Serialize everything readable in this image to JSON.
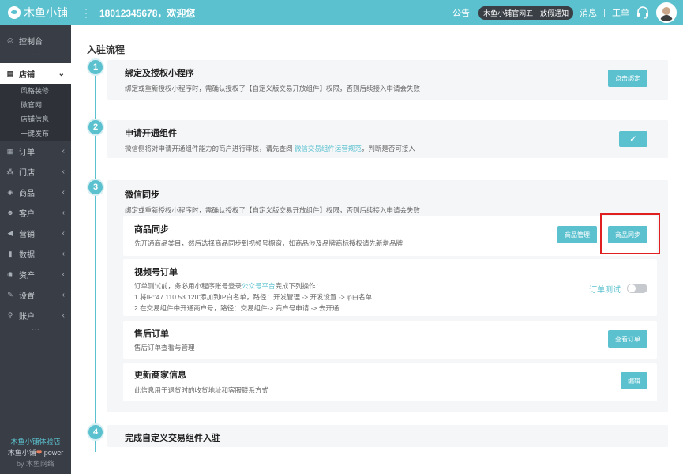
{
  "topbar": {
    "brand": "木鱼小铺",
    "menu_icon": "⋮",
    "welcome": "18012345678，欢迎您",
    "notice_label": "公告:",
    "notice_tag": "木鱼小铺官网五一放假通知",
    "messages": "消息",
    "divider": "|",
    "workorder": "工单"
  },
  "sidebar": {
    "items": [
      {
        "label": "控制台",
        "icon": "dashboard-icon",
        "glyph": "◎"
      },
      {
        "label": "店铺",
        "icon": "store-icon",
        "glyph": "▤",
        "arrow": "⌄"
      },
      {
        "label": "订单",
        "icon": "order-icon",
        "glyph": "▦",
        "arrow": "‹"
      },
      {
        "label": "门店",
        "icon": "branch-icon",
        "glyph": "⁂",
        "arrow": "‹"
      },
      {
        "label": "商品",
        "icon": "goods-icon",
        "glyph": "◈",
        "arrow": "‹"
      },
      {
        "label": "客户",
        "icon": "customer-icon",
        "glyph": "☻",
        "arrow": "‹"
      },
      {
        "label": "营销",
        "icon": "marketing-icon",
        "glyph": "◀",
        "arrow": "‹"
      },
      {
        "label": "数据",
        "icon": "data-icon",
        "glyph": "▮",
        "arrow": "‹"
      },
      {
        "label": "资产",
        "icon": "asset-icon",
        "glyph": "◉",
        "arrow": "‹"
      },
      {
        "label": "设置",
        "icon": "settings-icon",
        "glyph": "✎",
        "arrow": "‹"
      },
      {
        "label": "账户",
        "icon": "account-icon",
        "glyph": "⚲",
        "arrow": "‹"
      }
    ],
    "store_sub": [
      "风格装修",
      "微官网",
      "店铺信息",
      "一键发布"
    ],
    "dots": "···",
    "footer_shop": "木鱼小铺体验店",
    "footer_power_a": "木鱼小铺",
    "footer_heart": "❤",
    "footer_power_b": " power",
    "footer_by": "by 木鱼网络"
  },
  "main": {
    "page_title": "入驻流程",
    "steps": [
      {
        "num": "1",
        "title": "绑定及授权小程序",
        "desc": "绑定或重新授权小程序时，需确认授权了【自定义版交易开放组件】权限，否则后续接入申请会失败",
        "button": "点击绑定"
      },
      {
        "num": "2",
        "title": "申请开通组件",
        "desc_a": "微信侧将对申请开通组件能力的商户进行审核，请先查阅 ",
        "desc_link": "微信交易组件运营规范",
        "desc_b": "，判断是否可接入",
        "button": "✓"
      },
      {
        "num": "3",
        "title": "微信同步",
        "desc": "绑定或重新授权小程序时，需确认授权了【自定义版交易开放组件】权限，否则后续接入申请会失败",
        "subs": [
          {
            "title": "商品同步",
            "desc": "先开通商品类目，然后选择商品同步到视频号橱窗，如商品涉及品牌商标授权请先新增品牌",
            "btn_manage": "商品管理",
            "btn_sync": "商品同步"
          },
          {
            "title": "视频号订单",
            "line1_a": "订单测试前，务必用小程序账号登录",
            "line1_link": "公众号平台",
            "line1_b": "完成下列操作：",
            "line2": "1.将IP:'47.110.53.120'添加到IP白名单，路径：开发管理 -> 开发设置 -> ip白名单",
            "line3": "2.在交易组件中开通商户号，路径：交易组件-> 商户号申请 -> 去开通",
            "toggle_label": "订单测试",
            "toggle_on": false
          },
          {
            "title": "售后订单",
            "desc": "售后订单查看与管理",
            "button": "查看订单"
          },
          {
            "title": "更新商家信息",
            "desc": "此信息用于退货时的收货地址和客服联系方式",
            "button": "编辑"
          }
        ]
      },
      {
        "num": "4",
        "title": "完成自定义交易组件入驻"
      }
    ]
  },
  "colors": {
    "accent": "#5bc1cf",
    "sidebar_bg": "#393e46",
    "highlight": "#e02020"
  }
}
